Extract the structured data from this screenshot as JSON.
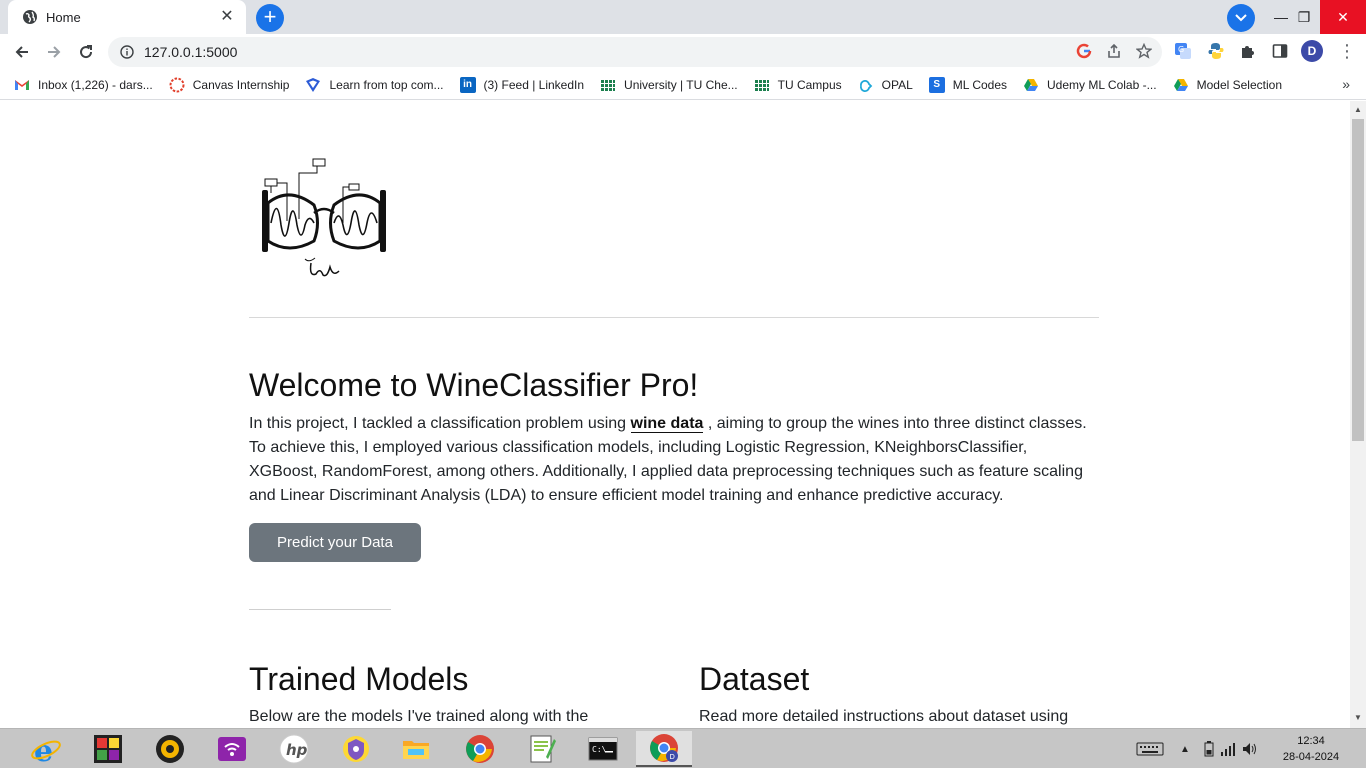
{
  "browser": {
    "tab_title": "Home",
    "tab_close": "✕",
    "new_tab": "+",
    "url": "127.0.0.1:5000",
    "profile_initial": "D",
    "window_controls": {
      "minimize": "—",
      "restore": "❐",
      "close": "✕"
    }
  },
  "bookmarks": [
    {
      "label": "Inbox (1,226) - dars...",
      "icon": "gmail-icon",
      "color": "#ea4335"
    },
    {
      "label": "Canvas Internship",
      "icon": "canvas-icon",
      "color": "#e13f2b"
    },
    {
      "label": "Learn from top com...",
      "icon": "learn-icon",
      "color": "#2c5bd6"
    },
    {
      "label": "(3) Feed | LinkedIn",
      "icon": "linkedin-icon",
      "color": "#0a66c2"
    },
    {
      "label": "University | TU Che...",
      "icon": "tu-icon",
      "color": "#1c7f4e"
    },
    {
      "label": "TU Campus",
      "icon": "tu-campus-icon",
      "color": "#1c7f4e"
    },
    {
      "label": "OPAL",
      "icon": "opal-icon",
      "color": "#1fa8d8"
    },
    {
      "label": "ML Codes",
      "icon": "ml-codes-icon",
      "color": "#1c6fe0"
    },
    {
      "label": "Udemy ML Colab -...",
      "icon": "google-drive-icon",
      "color": "#f4b400"
    },
    {
      "label": "Model Selection",
      "icon": "google-drive-icon",
      "color": "#f4b400"
    }
  ],
  "page": {
    "title": "Welcome to WineClassifier Pro!",
    "intro_before": "In this project, I tackled a classification problem using ",
    "intro_highlight": "wine data",
    "intro_after": " , aiming to group the wines into three distinct classes. To achieve this, I employed various classification models, including Logistic Regression, KNeighborsClassifier, XGBoost, RandomForest, among others. Additionally, I applied data preprocessing techniques such as feature scaling and Linear Discriminant Analysis (LDA) to ensure efficient model training and enhance predictive accuracy.",
    "predict_button": "Predict your Data",
    "models": {
      "title": "Trained Models",
      "text": "Below are the models I've trained along with the"
    },
    "dataset": {
      "title": "Dataset",
      "text": "Read more detailed instructions about dataset using"
    }
  },
  "taskbar": {
    "clock_time": "12:34",
    "clock_date": "28-04-2024",
    "apps": [
      "internet-explorer",
      "app-grid",
      "media-player",
      "wifi-app",
      "hp",
      "vpn",
      "file-explorer",
      "chrome",
      "notepad-plus-plus",
      "command-prompt",
      "chrome-profile"
    ]
  }
}
